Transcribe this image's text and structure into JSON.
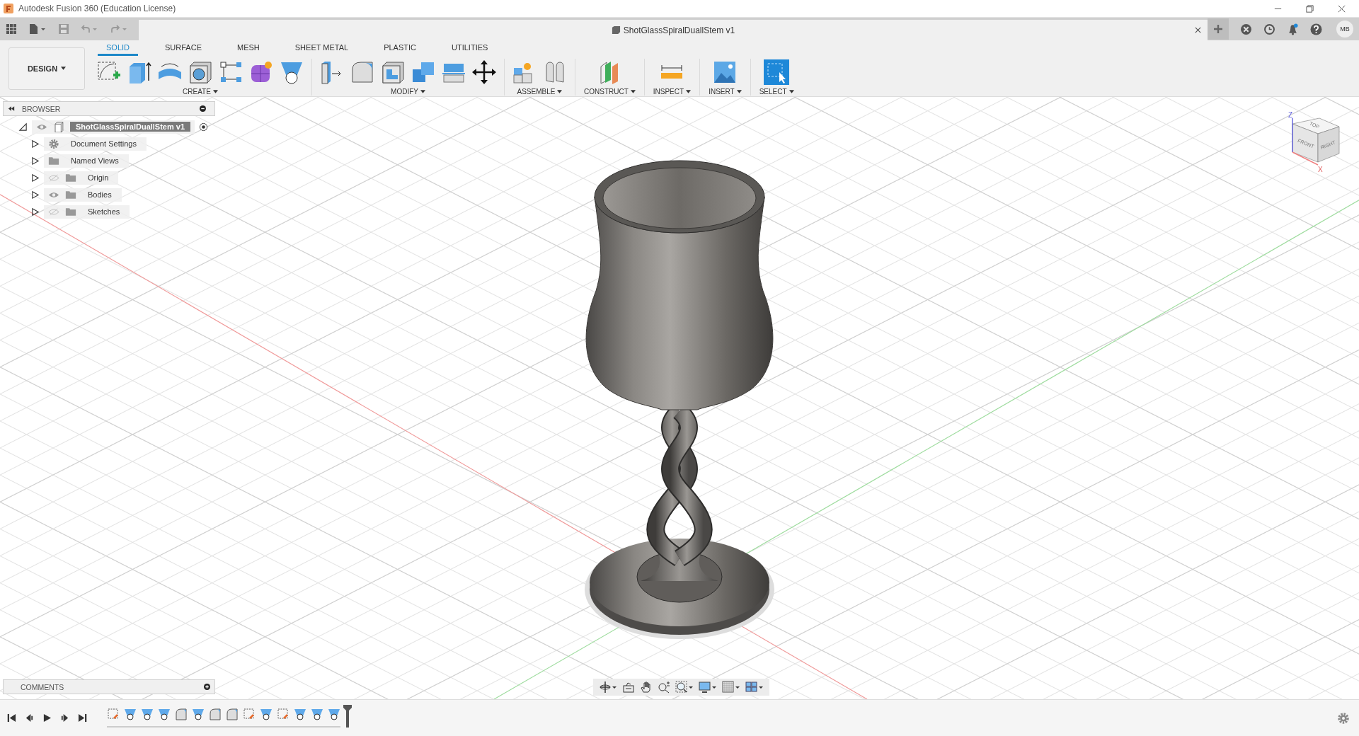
{
  "window": {
    "title": "Autodesk Fusion 360 (Education License)"
  },
  "document_tab": {
    "title": "ShotGlassSpiralDuallStem v1"
  },
  "user": {
    "initials": "MB"
  },
  "workspace": {
    "label": "DESIGN"
  },
  "toolbar_tabs": [
    {
      "label": "SOLID",
      "selected": true
    },
    {
      "label": "SURFACE",
      "selected": false
    },
    {
      "label": "MESH",
      "selected": false
    },
    {
      "label": "SHEET METAL",
      "selected": false
    },
    {
      "label": "PLASTIC",
      "selected": false
    },
    {
      "label": "UTILITIES",
      "selected": false
    }
  ],
  "toolbar_groups": [
    {
      "label": "CREATE",
      "tools": [
        {
          "kind": "sketch"
        },
        {
          "kind": "extrude"
        },
        {
          "kind": "revolve"
        },
        {
          "kind": "hole"
        },
        {
          "kind": "pattern"
        },
        {
          "kind": "form"
        },
        {
          "kind": "loft"
        }
      ]
    },
    {
      "label": "MODIFY",
      "tools": [
        {
          "kind": "presspull"
        },
        {
          "kind": "fillet"
        },
        {
          "kind": "shell"
        },
        {
          "kind": "combine"
        },
        {
          "kind": "split"
        },
        {
          "kind": "move"
        }
      ]
    },
    {
      "label": "ASSEMBLE",
      "tools": [
        {
          "kind": "component"
        },
        {
          "kind": "joint"
        }
      ]
    },
    {
      "label": "CONSTRUCT",
      "tools": [
        {
          "kind": "plane"
        }
      ]
    },
    {
      "label": "INSPECT",
      "tools": [
        {
          "kind": "measure"
        }
      ]
    },
    {
      "label": "INSERT",
      "tools": [
        {
          "kind": "image"
        }
      ]
    },
    {
      "label": "SELECT",
      "tools": [
        {
          "kind": "select"
        }
      ]
    }
  ],
  "browser": {
    "title": "BROWSER",
    "tree": [
      {
        "label": "ShotGlassSpiralDuallStem v1",
        "kind": "component",
        "visible": true,
        "expanded": true,
        "selected": true,
        "children": [
          {
            "label": "Document Settings",
            "kind": "settings",
            "expanded": false,
            "selected": false
          },
          {
            "label": "Named Views",
            "kind": "folder",
            "expanded": false,
            "selected": false
          },
          {
            "label": "Origin",
            "kind": "folder",
            "visible": false,
            "expanded": false,
            "selected": false
          },
          {
            "label": "Bodies",
            "kind": "folder",
            "visible": true,
            "expanded": false,
            "selected": false
          },
          {
            "label": "Sketches",
            "kind": "folder",
            "visible": false,
            "expanded": false,
            "selected": false
          }
        ]
      }
    ]
  },
  "comments": {
    "title": "COMMENTS"
  },
  "viewcube": {
    "faces": [
      "TOP",
      "FRONT",
      "RIGHT"
    ],
    "axes": [
      "Z",
      "X"
    ]
  },
  "timeline": {
    "features": [
      {
        "kind": "sketch"
      },
      {
        "kind": "loft"
      },
      {
        "kind": "loft"
      },
      {
        "kind": "loft"
      },
      {
        "kind": "fillet"
      },
      {
        "kind": "loft"
      },
      {
        "kind": "fillet"
      },
      {
        "kind": "fillet"
      },
      {
        "kind": "sketch"
      },
      {
        "kind": "loft"
      },
      {
        "kind": "sketch"
      },
      {
        "kind": "loft"
      },
      {
        "kind": "loft"
      },
      {
        "kind": "loft"
      }
    ]
  }
}
